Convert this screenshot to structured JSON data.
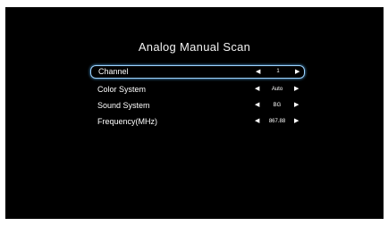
{
  "page": {
    "title": "Analog Manual Scan"
  },
  "menu": {
    "rows": [
      {
        "label": "Channel",
        "value": "1",
        "selected": true
      },
      {
        "label": "Color System",
        "value": "Auto",
        "selected": false
      },
      {
        "label": "Sound System",
        "value": "BG",
        "selected": false
      },
      {
        "label": "Frequency(MHz)",
        "value": "867.88",
        "selected": false
      }
    ]
  },
  "icons": {
    "left": "triangle-left",
    "right": "triangle-right"
  },
  "colors": {
    "background": "#000000",
    "text": "#ffffff",
    "highlight": "#9fd4ff"
  }
}
